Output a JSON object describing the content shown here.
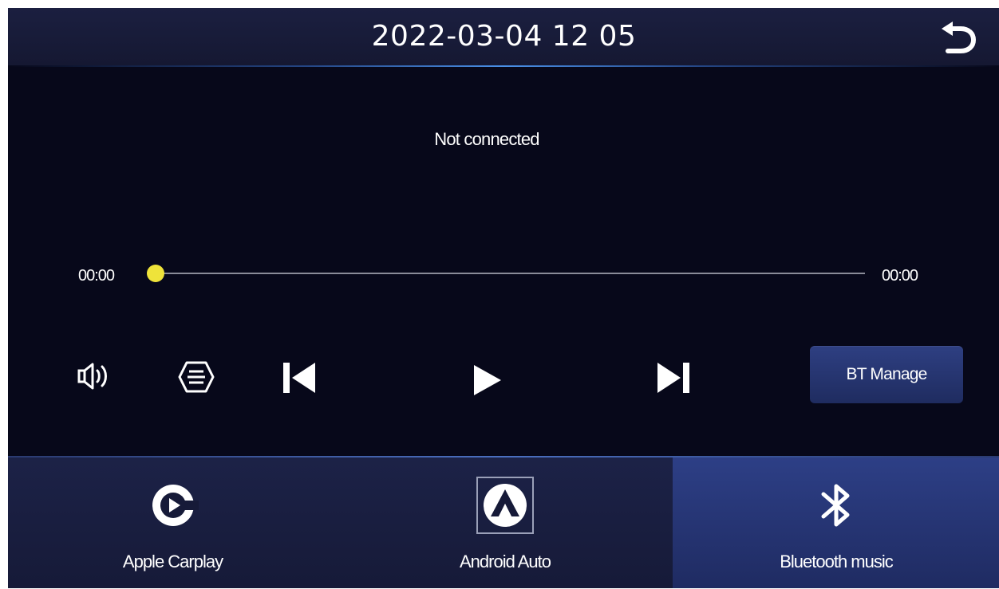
{
  "header": {
    "datetime": "2022-03-04  12 05",
    "back_icon": "back-arrow-icon"
  },
  "player": {
    "status": "Not connected",
    "time_elapsed": "00:00",
    "time_total": "00:00",
    "progress": 0,
    "accent_color": "#efe33a"
  },
  "controls": {
    "volume_icon": "volume-icon",
    "playlist_icon": "list-icon",
    "prev_icon": "previous-track-icon",
    "play_icon": "play-icon",
    "next_icon": "next-track-icon",
    "bt_manage_label": "BT Manage"
  },
  "tabs": [
    {
      "label": "Apple Carplay",
      "icon": "carplay-icon",
      "active": false
    },
    {
      "label": "Android Auto",
      "icon": "android-auto-icon",
      "active": false
    },
    {
      "label": "Bluetooth music",
      "icon": "bluetooth-icon",
      "active": true
    }
  ],
  "colors": {
    "background": "#07081a",
    "header": "#1b1f40",
    "active_tab": "#2d3f86",
    "button": "#2e3f82"
  }
}
